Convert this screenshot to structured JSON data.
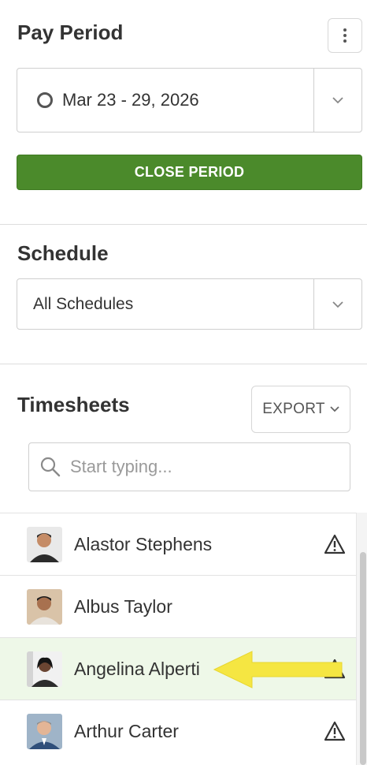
{
  "pay_period": {
    "title": "Pay Period",
    "selected_range": "Mar 23 - 29, 2026",
    "close_button_label": "CLOSE PERIOD"
  },
  "schedule": {
    "title": "Schedule",
    "selected": "All Schedules"
  },
  "timesheets": {
    "title": "Timesheets",
    "export_label": "EXPORT",
    "search_placeholder": "Start typing...",
    "employees": [
      {
        "name": "Alastor Stephens",
        "warning": true
      },
      {
        "name": "Albus Taylor",
        "warning": false
      },
      {
        "name": "Angelina Alperti",
        "warning": true
      },
      {
        "name": "Arthur Carter",
        "warning": true
      }
    ]
  },
  "colors": {
    "primary_green": "#4b8a2b",
    "selected_row_bg": "#eef8e8",
    "annotation_arrow": "#f5e642"
  }
}
